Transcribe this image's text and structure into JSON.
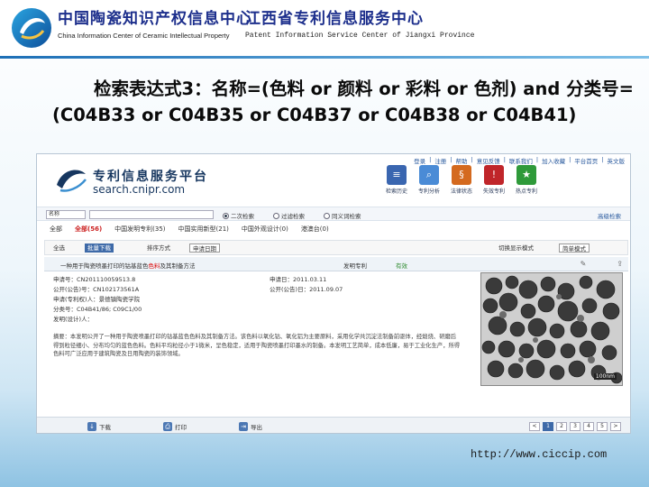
{
  "header": {
    "org1_cn": "中国陶瓷知识产权信息中心",
    "org1_en": "China Information Center of Ceramic Intellectual Property",
    "org2_cn": "江西省专利信息服务中心",
    "org2_en": "Patent Information Service Center of Jiangxi Province"
  },
  "title": "检索表达式3：名称=(色料 or 颜料 or 彩料 or 色剂) and 分类号=(C04B33 or C04B35 or C04B37 or C04B38 or C04B41)",
  "site": {
    "name": "专利信息服务平台",
    "url": "search.cnipr.com",
    "top_links": [
      "登录",
      "注册",
      "帮助",
      "意见反馈",
      "联系我们",
      "加入收藏",
      "平台首页",
      "英文版"
    ],
    "tools": [
      {
        "label": "检索历史",
        "icon": "history-icon",
        "color": "#3a66b0"
      },
      {
        "label": "专利分析",
        "icon": "analysis-icon",
        "color": "#4a8bd6"
      },
      {
        "label": "法律状态",
        "icon": "law-icon",
        "color": "#d46a1f"
      },
      {
        "label": "失效专利",
        "icon": "expired-icon",
        "color": "#c0262a"
      },
      {
        "label": "热点专利",
        "icon": "hot-icon",
        "color": "#2f9a3a"
      }
    ]
  },
  "search": {
    "select_value": "名称",
    "options": [
      "二次检索",
      "过滤检索",
      "同义词检索"
    ],
    "advanced": "高级检索"
  },
  "tabs": [
    "全部",
    "全部(56)",
    "中国发明专利(35)",
    "中国实用新型(21)",
    "中国外观设计(0)",
    "港澳台(0)"
  ],
  "ops": {
    "select_all": "全选",
    "batch": "批量下载",
    "sort_label": "排序方式",
    "sort_value": "申请日期",
    "view": "切换显示模式",
    "mode": "简单模式"
  },
  "result": {
    "title": "一种用于陶瓷喷墨打印的钴基蓝色色料及其制备方法",
    "type": "发明专利",
    "law_status": "有效"
  },
  "record": {
    "app_no_label": "申请号：",
    "app_no": "CN201110059513.8",
    "app_date_label": "申请日：",
    "app_date": "2011.03.11",
    "pub_no_label": "公开(公告)号：",
    "pub_no": "CN102173561A",
    "pub_date_label": "公开(公告)日：",
    "pub_date": "2011.09.07",
    "applicant_label": "申请(专利权)人：",
    "applicant": "景德镇陶瓷学院",
    "class_label": "分类号：",
    "class_value": "C04B41/86; C09C1/00",
    "inventor_label": "发明(设计)人：",
    "abstract_label": "摘要：",
    "abstract": "本发明公开了一种用于陶瓷喷墨打印的钴基蓝色色料及其制备方法。该色料以氧化钴、氧化铝为主要原料，采用化学共沉淀法制备前驱体，经煅烧、研磨后得到粒径细小、分布均匀的蓝色色料。色料平均粒径小于1微米，呈色稳定，适用于陶瓷喷墨打印墨水的制备。本发明工艺简单，成本低廉，易于工业化生产，所得色料可广泛应用于建筑陶瓷及日用陶瓷的装饰领域。"
  },
  "image": {
    "scale_label": "100nm"
  },
  "bottom": {
    "download": "下载",
    "print": "打印",
    "export": "导出",
    "pages": [
      "<",
      "1",
      "2",
      "3",
      "4",
      "5",
      ">"
    ]
  },
  "footer_url": "http://www.ciccip.com",
  "colors": {
    "accent": "#1d2f8c",
    "highlight": "#dd0000"
  }
}
